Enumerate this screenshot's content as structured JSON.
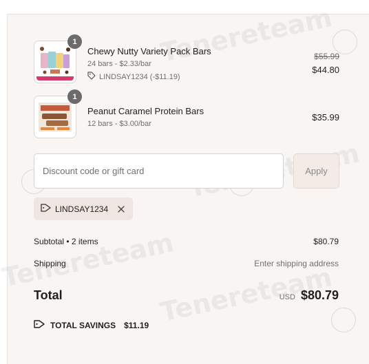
{
  "line_items": [
    {
      "name": "Chewy Nutty Variety Pack Bars",
      "quantity": "1",
      "unit_info": "24 bars - $2.33/bar",
      "discount_text": "LINDSAY1234 (-$11.19)",
      "original_price": "$55.99",
      "price": "$44.80"
    },
    {
      "name": "Peanut Caramel Protein Bars",
      "quantity": "1",
      "unit_info": "12 bars - $3.00/bar",
      "price": "$35.99"
    }
  ],
  "discount": {
    "placeholder": "Discount code or gift card",
    "value": "",
    "apply_label": "Apply",
    "applied_code": "LINDSAY1234"
  },
  "summary": {
    "subtotal_label": "Subtotal • 2 items",
    "subtotal_value": "$80.79",
    "shipping_label": "Shipping",
    "shipping_value": "Enter shipping address",
    "total_label": "Total",
    "currency": "USD",
    "total_value": "$80.79",
    "savings_label": "TOTAL SAVINGS",
    "savings_value": "$11.19"
  },
  "colors": {
    "panel_bg": "#f8f5f3",
    "apply_bg": "#f3ebe6",
    "chip_bg": "#efe6e1",
    "badge_bg": "#6b6b6b"
  },
  "icons": [
    "tag-icon",
    "close-icon",
    "savings-tag-icon"
  ]
}
